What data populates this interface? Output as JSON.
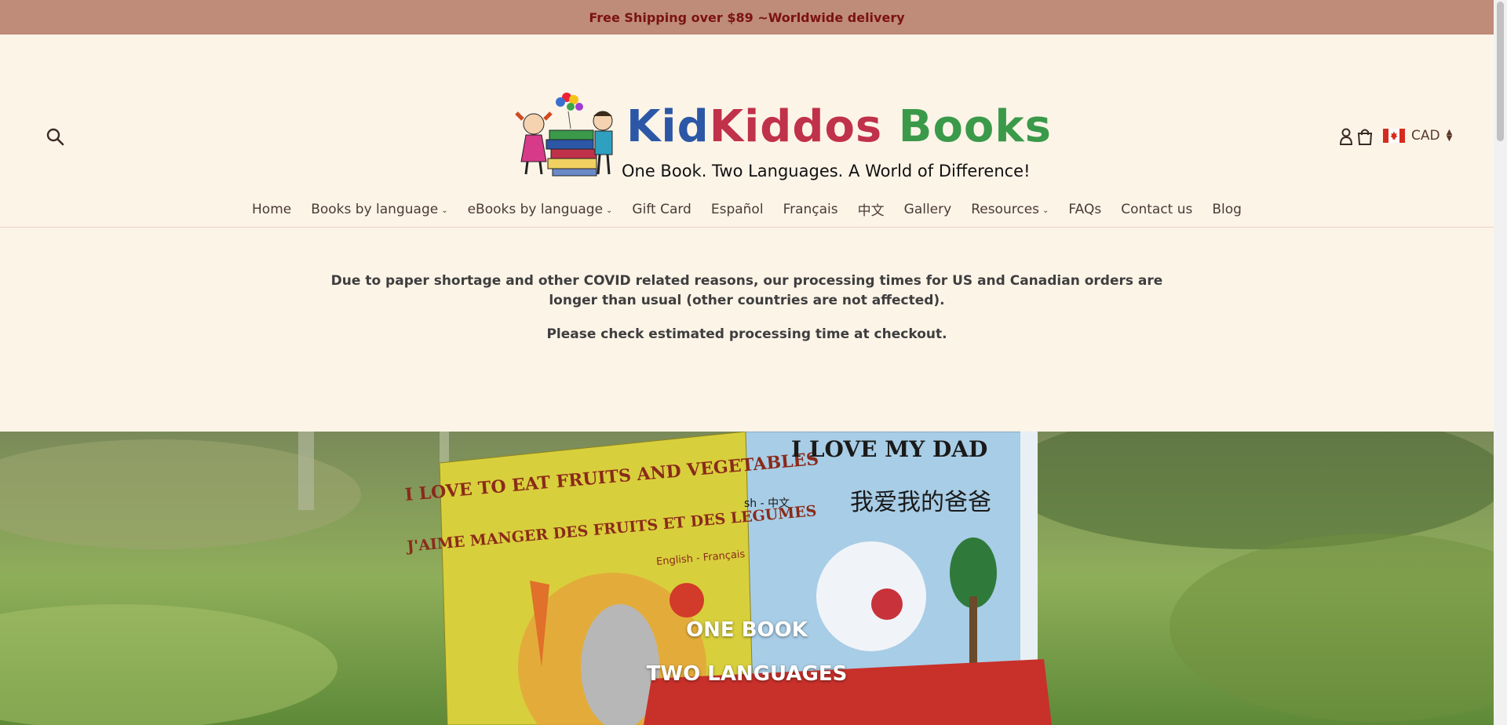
{
  "announcement": {
    "text": "Free Shipping over $89 ~Worldwide delivery"
  },
  "header": {
    "logo": {
      "title_part1": "Kid",
      "title_part2": "Kiddos",
      "title_part3": "Books",
      "tagline": "One Book. Two Languages. A World of Difference!"
    },
    "currency": {
      "label": "CAD",
      "flag": "canada-flag"
    },
    "icons": [
      "search-icon",
      "account-icon",
      "cart-icon"
    ]
  },
  "nav": {
    "items": [
      {
        "label": "Home",
        "dropdown": false
      },
      {
        "label": "Books by language",
        "dropdown": true
      },
      {
        "label": "eBooks by language",
        "dropdown": true
      },
      {
        "label": "Gift Card",
        "dropdown": false
      },
      {
        "label": "Español",
        "dropdown": false
      },
      {
        "label": "Français",
        "dropdown": false
      },
      {
        "label": "中文",
        "dropdown": false
      },
      {
        "label": "Gallery",
        "dropdown": false
      },
      {
        "label": "Resources",
        "dropdown": true
      },
      {
        "label": "FAQs",
        "dropdown": false
      },
      {
        "label": "Contact us",
        "dropdown": false
      },
      {
        "label": "Blog",
        "dropdown": false
      }
    ]
  },
  "notice": {
    "line1": "Due to paper shortage and other COVID related reasons, our processing times for US and Canadian orders are longer than usual (other countries are not affected).",
    "line2": "Please check estimated processing time at checkout."
  },
  "hero": {
    "line1": "ONE BOOK",
    "line2": "TWO LANGUAGES",
    "book1_title": "I LOVE TO EAT FRUITS AND VEGETABLES",
    "book1_subtitle": "J'AIME MANGER DES FRUITS ET DES LEGUMES",
    "book1_lang": "English - Français",
    "book2_title": "I LOVE MY DAD",
    "book2_chinese": "我爱我的爸爸",
    "book2_lang": "sh - 中文"
  },
  "colors": {
    "announcement_bg": "#be8c78",
    "announcement_text": "#7b1212",
    "page_bg": "#fdf4e8"
  }
}
